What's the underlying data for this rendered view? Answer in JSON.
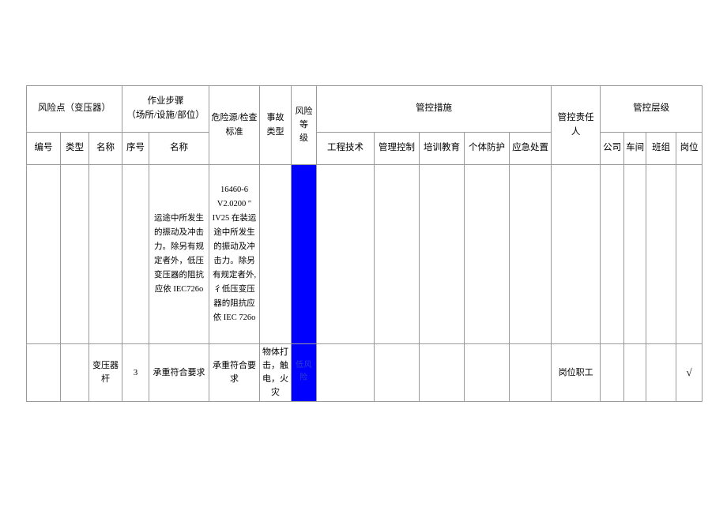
{
  "table": {
    "header_groups": [
      {
        "label": "风险点（变压器）",
        "colspan": 3
      },
      {
        "label": "作业步骤\n（场所/设施/部位）",
        "colspan": 2
      },
      {
        "label": "危险源/检查标准",
        "rowspan": 2
      },
      {
        "label": "事故类型",
        "rowspan": 2
      },
      {
        "label": "风险等级",
        "rowspan": 2
      },
      {
        "label": "管控措施",
        "colspan": 5
      },
      {
        "label": "管控责任人",
        "rowspan": 2
      },
      {
        "label": "管控层级",
        "colspan": 4
      }
    ],
    "header_group_labels": {
      "risk_point": "风险点（变压器）",
      "work_step_line1": "作业步骤",
      "work_step_line2": "（场所/设施/部位）",
      "hazard_source_line1": "危险源/检查",
      "hazard_source_line2": "标准",
      "accident_type_line1": "事故",
      "accident_type_line2": "类型",
      "risk_level_line1": "风险等",
      "risk_level_line2": "级",
      "control_measures": "管控措施",
      "control_person": "管控责任人",
      "control_level": "管控层级"
    },
    "sub_headers": {
      "number": "编号",
      "type": "类型",
      "name": "名称",
      "seq": "序号",
      "step_name": "名称",
      "engineering_tech": "工程技术",
      "management_control": "管理控制",
      "training_education": "培训教育",
      "personal_protection": "个体防护",
      "emergency_response": "应急处置",
      "company": "公司",
      "workshop": "车间",
      "team": "班组",
      "post": "岗位"
    },
    "rows": [
      {
        "number": "",
        "type": "",
        "name": "",
        "seq": "",
        "step_name": "运途中所发生的振动及冲击力。除另有规定者外，低压变压器的阻抗\n应依 IEC726o",
        "hazard_source": "16460-6\nV2.0200 ″\nIV25 在装运途中所发生的振动及冲击力。除另有规定者外, 彳低压变压器的阻抗应依 IEC 726o",
        "accident_type": "",
        "risk_level": "",
        "risk_level_color": "#0000FF",
        "engineering_tech": "",
        "management_control": "",
        "training_education": "",
        "personal_protection": "",
        "emergency_response": "",
        "control_person": "",
        "company": "",
        "workshop": "",
        "team": "",
        "post": ""
      },
      {
        "number": "",
        "type": "",
        "name": "变压器杆",
        "seq": "3",
        "step_name": "承重符合要求",
        "hazard_source": "承重符合要求",
        "accident_type": "物体打击，触电，火灾",
        "risk_level": "低风险",
        "risk_level_color": "#0000FF",
        "engineering_tech": "",
        "management_control": "",
        "training_education": "",
        "personal_protection": "",
        "emergency_response": "",
        "control_person": "岗位职工",
        "company": "",
        "workshop": "",
        "team": "",
        "post": "√"
      }
    ]
  }
}
